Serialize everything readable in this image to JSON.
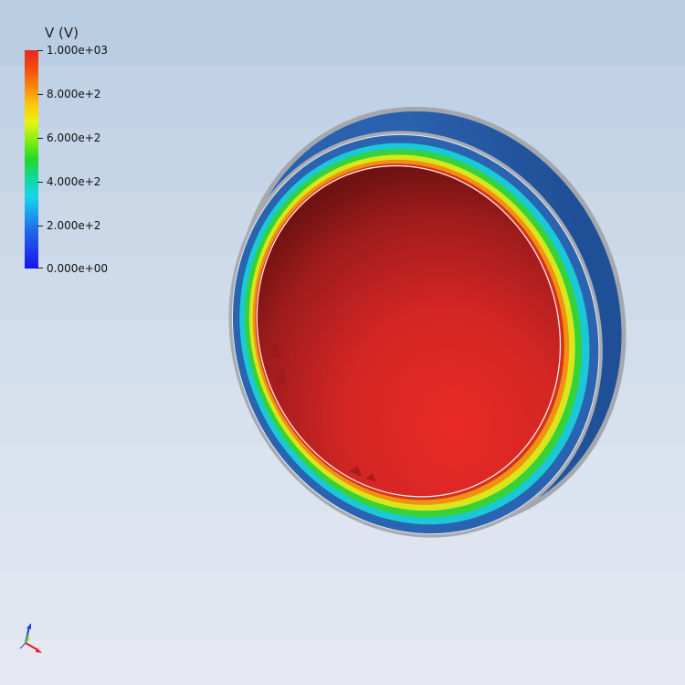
{
  "viewport": {
    "object": "hemispherical-shell",
    "colormap": "rainbow",
    "colors": {
      "inner_surface": "#e02a22",
      "outer_surface": "#2a63b0",
      "rim_bands": [
        "#2a63b0",
        "#14d8e6",
        "#22d82a",
        "#e8f514",
        "#f78a0a",
        "#e8281e"
      ]
    }
  },
  "legend": {
    "title": "V (V)",
    "range": [
      0,
      1000
    ],
    "ticks": [
      {
        "label": "1.000e+03",
        "value": 1000
      },
      {
        "label": "8.000e+2",
        "value": 800
      },
      {
        "label": "6.000e+2",
        "value": 600
      },
      {
        "label": "4.000e+2",
        "value": 400
      },
      {
        "label": "2.000e+2",
        "value": 200
      },
      {
        "label": "0.000e+00",
        "value": 0
      }
    ]
  },
  "axes_triad": {
    "icon": "orientation-axes-icon",
    "colors": {
      "x": "#e02020",
      "y": "#e0e020",
      "z": "#2040e0"
    }
  }
}
